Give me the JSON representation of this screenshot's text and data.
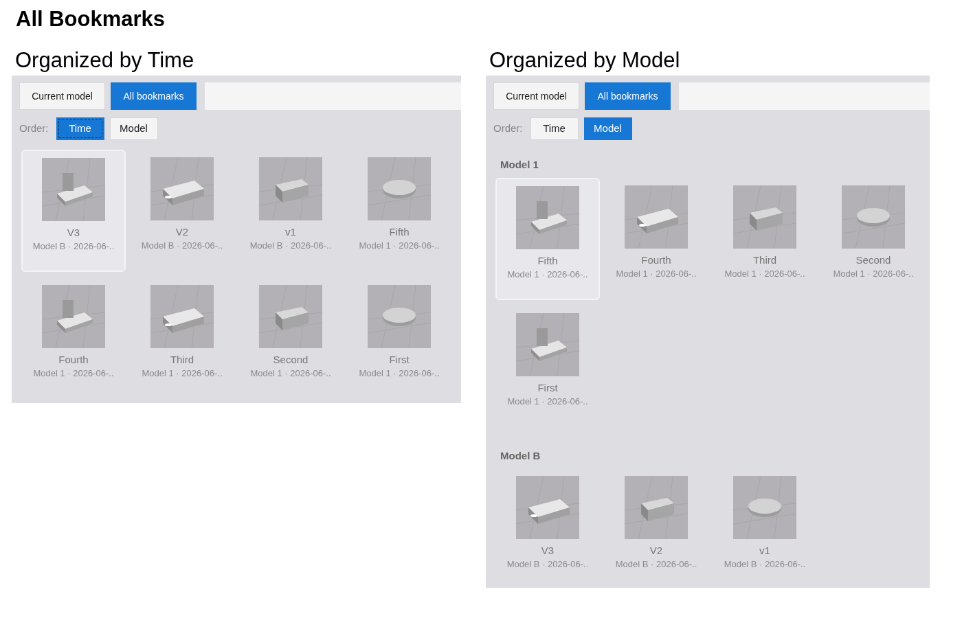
{
  "heading": "All Bookmarks",
  "panels": [
    {
      "title": "Organized by Time",
      "tabs": [
        {
          "label": "Current model",
          "selected": false
        },
        {
          "label": "All bookmarks",
          "selected": true
        }
      ],
      "order_label": "Order:",
      "order_options": [
        {
          "label": "Time",
          "selected": true,
          "focused": true
        },
        {
          "label": "Model",
          "selected": false,
          "focused": false
        }
      ],
      "groups": [
        {
          "bookmarks": [
            {
              "title": "V3",
              "meta": "Model B · 2026-06-..",
              "selected": true
            },
            {
              "title": "V2",
              "meta": "Model B · 2026-06-..",
              "selected": false
            },
            {
              "title": "v1",
              "meta": "Model B · 2026-06-..",
              "selected": false
            },
            {
              "title": "Fifth",
              "meta": "Model 1 · 2026-06-..",
              "selected": false
            },
            {
              "title": "Fourth",
              "meta": "Model 1 · 2026-06-..",
              "selected": false
            },
            {
              "title": "Third",
              "meta": "Model 1 · 2026-06-..",
              "selected": false
            },
            {
              "title": "Second",
              "meta": "Model 1 · 2026-06-..",
              "selected": false
            },
            {
              "title": "First",
              "meta": "Model 1 · 2026-06-..",
              "selected": false
            }
          ]
        }
      ]
    },
    {
      "title": "Organized by Model",
      "tabs": [
        {
          "label": "Current model",
          "selected": false
        },
        {
          "label": "All bookmarks",
          "selected": true
        }
      ],
      "order_label": "Order:",
      "order_options": [
        {
          "label": "Time",
          "selected": false,
          "focused": false
        },
        {
          "label": "Model",
          "selected": true,
          "focused": false
        }
      ],
      "groups": [
        {
          "heading": "Model 1",
          "bookmarks": [
            {
              "title": "Fifth",
              "meta": "Model 1 · 2026-06-..",
              "selected": true
            },
            {
              "title": "Fourth",
              "meta": "Model 1 · 2026-06-..",
              "selected": false
            },
            {
              "title": "Third",
              "meta": "Model 1 · 2026-06-..",
              "selected": false
            },
            {
              "title": "Second",
              "meta": "Model 1 · 2026-06-..",
              "selected": false
            },
            {
              "title": "First",
              "meta": "Model 1 · 2026-06-..",
              "selected": false
            }
          ]
        },
        {
          "heading": "Model B",
          "bookmarks": [
            {
              "title": "V3",
              "meta": "Model B · 2026-06-..",
              "selected": false
            },
            {
              "title": "V2",
              "meta": "Model B · 2026-06-..",
              "selected": false
            },
            {
              "title": "v1",
              "meta": "Model B · 2026-06-..",
              "selected": false
            }
          ]
        }
      ]
    }
  ]
}
